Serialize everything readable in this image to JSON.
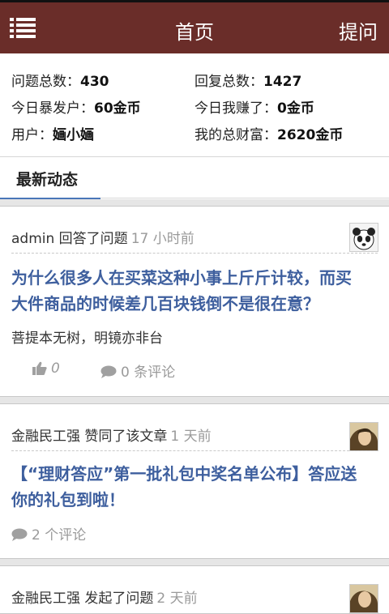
{
  "header": {
    "title": "首页",
    "ask_label": "提问"
  },
  "stats": {
    "questions": {
      "label": "问题总数：",
      "value": "430"
    },
    "replies": {
      "label": "回复总数：",
      "value": "1427"
    },
    "today_rich": {
      "label": "今日暴发户：",
      "value": "60金币"
    },
    "today_earned": {
      "label": "今日我赚了：",
      "value": "0金币"
    },
    "user": {
      "label": "用户：",
      "value": "婳小婳"
    },
    "wealth": {
      "label": "我的总财富：",
      "value": "2620金币"
    }
  },
  "tabs": {
    "latest": "最新动态"
  },
  "feed": [
    {
      "actor": "admin",
      "action": " 回答了问题",
      "time": "17 小时前",
      "title_line1": "为什么很多人在买菜这种小事上斤斤计较，而买",
      "title_line2": "大件商品的时候差几百块钱倒不是很在意？",
      "answer": "菩提本无树，明镜亦非台",
      "likes": "0",
      "comments": "0 条评论"
    },
    {
      "actor": "金融民工强",
      "action": " 赞同了该文章",
      "time": "1 天前",
      "title_line1": "【“理财答应”第一批礼包中奖名单公布】答应送",
      "title_line2": "你的礼包到啦！",
      "comments": "2 个评论"
    },
    {
      "actor": "金融民工强",
      "action": " 发起了问题",
      "time": "2 天前"
    }
  ],
  "colors": {
    "header_bg": "#6a2d29",
    "link": "#3e5f9e",
    "tab_accent": "#4a76b8"
  }
}
